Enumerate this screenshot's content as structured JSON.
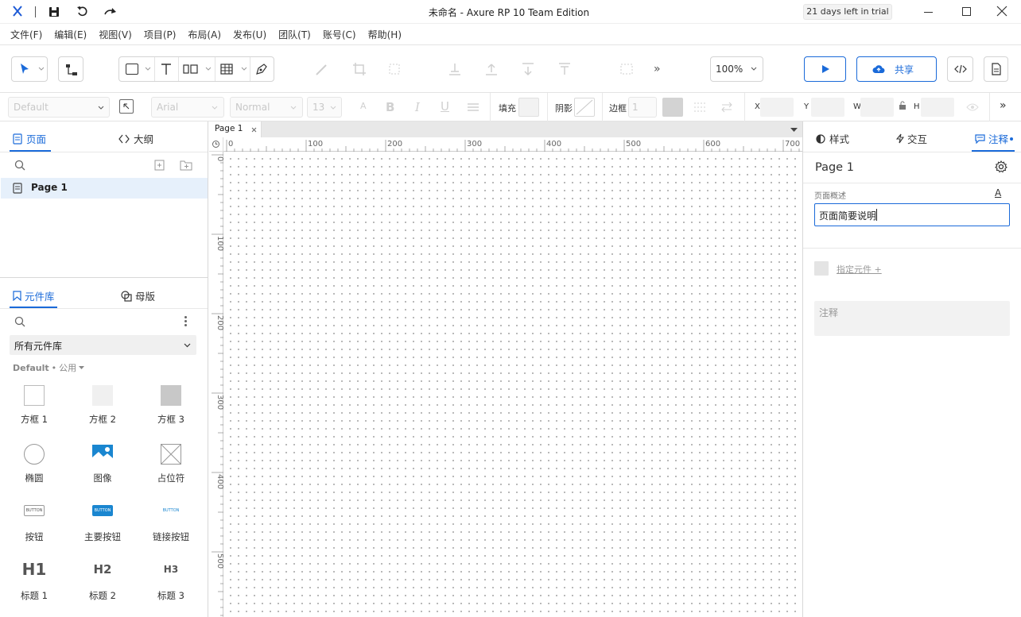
{
  "title": "未命名 - Axure RP 10 Team Edition",
  "trial": "21 days left in trial",
  "menu": [
    "文件(F)",
    "编辑(E)",
    "视图(V)",
    "项目(P)",
    "布局(A)",
    "发布(U)",
    "团队(T)",
    "账号(C)",
    "帮助(H)"
  ],
  "toolbar": {
    "zoom": "100%",
    "share": "共享"
  },
  "format": {
    "style": "Default",
    "font": "Arial",
    "weight": "Normal",
    "size": "13",
    "fill": "填充",
    "shadow": "阴影",
    "border": "边框",
    "border_value": "1",
    "x": "X",
    "y": "Y",
    "w": "W",
    "h": "H"
  },
  "left": {
    "tab_pages": "页面",
    "tab_outline": "大纲",
    "page_item": "Page 1",
    "tab_library": "元件库",
    "tab_masters": "母版",
    "library_select": "所有元件库",
    "library_name": "Default",
    "library_sep": "•",
    "library_group": "公用",
    "widgets": [
      "方框 1",
      "方框 2",
      "方框 3",
      "椭圆",
      "图像",
      "占位符",
      "按钮",
      "主要按钮",
      "链接按钮",
      "标题 1",
      "标题 2",
      "标题 3"
    ],
    "button_text": "BUTTON",
    "heading_labels": [
      "H1",
      "H2",
      "H3"
    ]
  },
  "canvas": {
    "tab": "Page 1",
    "ruler_h": [
      "0",
      "100",
      "200",
      "300",
      "400",
      "500",
      "600",
      "700"
    ],
    "ruler_v": [
      "0",
      "100",
      "200",
      "300",
      "400",
      "500"
    ]
  },
  "right": {
    "tab_style": "样式",
    "tab_interact": "交互",
    "tab_notes": "注释",
    "page_name": "Page 1",
    "desc_label": "页面概述",
    "desc_value": "页面简要说明",
    "assign_widget": "指定元件 +",
    "notes_placeholder": "注释"
  },
  "colors": {
    "accent": "#1a6ad9",
    "selected_bg": "#e6f0fb"
  }
}
